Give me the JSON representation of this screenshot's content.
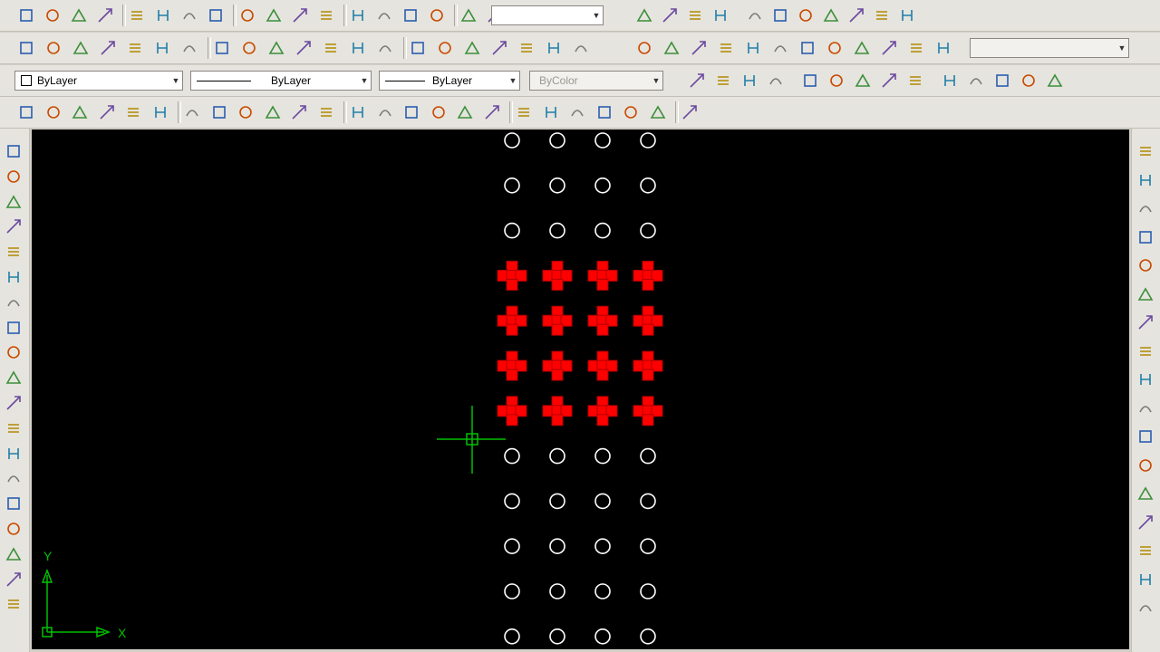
{
  "toolbars": {
    "properties": {
      "color_control": "ByLayer",
      "linetype_control": "ByLayer",
      "lineweight_control": "ByLayer",
      "plotstyle_control": "ByColor"
    },
    "dimension_style_value": "",
    "view_name_value": ""
  },
  "ucs": {
    "x_label": "X",
    "y_label": "Y"
  },
  "drawing": {
    "columns": 4,
    "rows": [
      {
        "kind": "circle"
      },
      {
        "kind": "circle"
      },
      {
        "kind": "circle"
      },
      {
        "kind": "cross"
      },
      {
        "kind": "cross"
      },
      {
        "kind": "cross"
      },
      {
        "kind": "cross"
      },
      {
        "kind": "circle"
      },
      {
        "kind": "circle"
      },
      {
        "kind": "circle"
      },
      {
        "kind": "circle"
      },
      {
        "kind": "circle"
      }
    ]
  },
  "colors": {
    "canvas_background": "#000000",
    "circle_stroke": "#ffffff",
    "selected_fill": "#ff0000",
    "selected_grip": "#b00000",
    "ucs_and_cursor": "#00c000",
    "toolbar_background": "#e6e4de"
  },
  "icons": {
    "row1": [
      "linear-dim-icon",
      "aligned-dim-icon",
      "arc-length-icon",
      "ordinate-icon",
      "radius-icon",
      "jogged-icon",
      "diameter-icon",
      "angular-icon",
      "quick-dim-icon",
      "baseline-icon",
      "continue-icon",
      "qleader-icon",
      "tolerance-icon",
      "center-mark-icon",
      "dimedit-icon",
      "dimtedit-icon",
      "dim-update-icon",
      "dimstyle-icon",
      "move-3d-icon",
      "rotate-3d-icon",
      "render-icon",
      "text-icon",
      "mtext-icon",
      "edit-text-icon",
      "find-icon",
      "spell-icon",
      "scale-text-icon",
      "justify-text-icon",
      "convert-space-icon"
    ],
    "row2": [
      "box-icon",
      "wedge-icon",
      "cone-icon",
      "sphere-icon",
      "cylinder-icon",
      "torus-icon",
      "pyramid-icon",
      "helix-icon",
      "planar-surface-icon",
      "extrude-icon",
      "presspull-icon",
      "sweep-icon",
      "revolve-icon",
      "loft-icon",
      "union-icon",
      "subtract-icon",
      "intersect-icon",
      "3d-orbit-icon",
      "free-orbit-icon",
      "continuous-orbit-icon",
      "named-views-icon",
      "top-view-icon",
      "bottom-view-icon",
      "left-view-icon",
      "right-view-icon",
      "front-view-icon",
      "back-view-icon",
      "sw-iso-icon",
      "se-iso-icon",
      "ne-iso-icon",
      "nw-iso-icon",
      "camera-icon",
      "ucs-prev-icon"
    ],
    "row4": [
      "new-icon",
      "open-icon",
      "save-icon",
      "plot-icon",
      "plot-preview-icon",
      "publish-icon",
      "3d-dwf-icon",
      "cut-icon",
      "copy-icon",
      "paste-icon",
      "match-prop-icon",
      "block-editor-icon",
      "undo-icon",
      "redo-icon",
      "pan-icon",
      "zoom-realtime-icon",
      "zoom-window-icon",
      "zoom-previous-icon",
      "properties-icon",
      "design-center-icon",
      "tool-palettes-icon",
      "sheet-set-icon",
      "markup-icon",
      "calculator-icon",
      "help-icon"
    ],
    "left": [
      "line-icon",
      "construction-line-icon",
      "polyline-icon",
      "polygon-icon",
      "rectangle-icon",
      "arc-icon",
      "circle-icon",
      "revcloud-icon",
      "spline-icon",
      "ellipse-icon",
      "ellipse-arc-icon",
      "insert-block-icon",
      "make-block-icon",
      "point-icon",
      "hatch-icon",
      "gradient-icon",
      "region-icon",
      "table-icon",
      "mtext-icon"
    ],
    "right": [
      "erase-icon",
      "copy-icon",
      "mirror-icon",
      "offset-icon",
      "array-icon",
      "move-icon",
      "rotate-icon",
      "scale-icon",
      "stretch-icon",
      "trim-icon",
      "extend-icon",
      "break-at-point-icon",
      "break-icon",
      "join-icon",
      "chamfer-icon",
      "fillet-icon",
      "explode-icon"
    ]
  }
}
